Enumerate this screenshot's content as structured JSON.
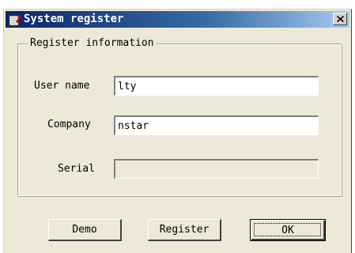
{
  "window": {
    "title": "System register",
    "icon": "edit-register-icon",
    "close_label": "close"
  },
  "group": {
    "legend": "Register information"
  },
  "fields": {
    "user_name": {
      "label": "User name",
      "value": "lty"
    },
    "company": {
      "label": "Company",
      "value": "nstar"
    },
    "serial": {
      "label": "Serial",
      "value": "",
      "enabled": false
    }
  },
  "buttons": {
    "demo": "Demo",
    "register": "Register",
    "ok": "OK"
  },
  "colors": {
    "title_start": "#0a246a",
    "title_end": "#a6caf0",
    "face": "#ece9d8"
  }
}
